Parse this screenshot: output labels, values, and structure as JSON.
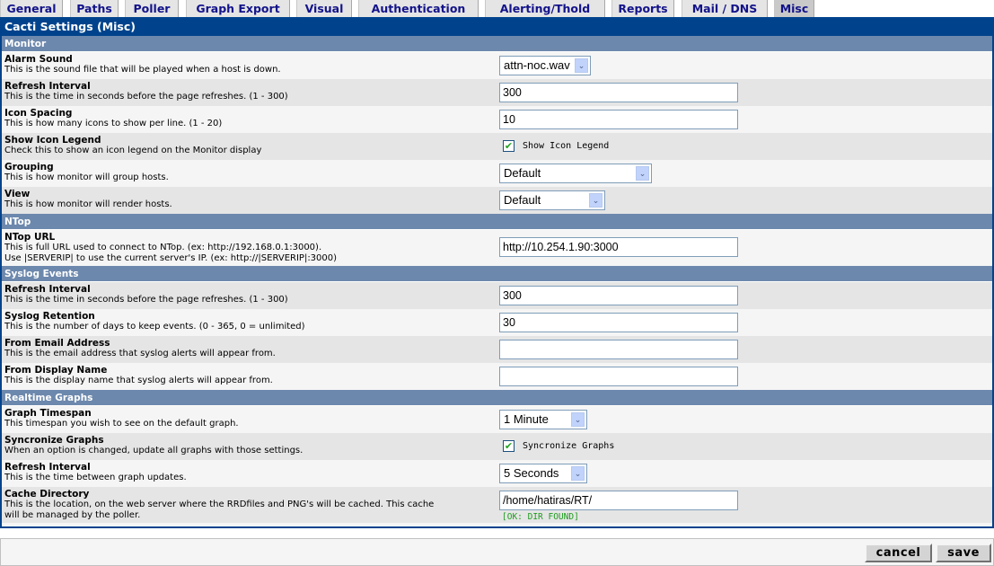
{
  "tabs": [
    {
      "label": "General",
      "active": false
    },
    {
      "label": "Paths",
      "active": false
    },
    {
      "label": "Poller",
      "active": false
    },
    {
      "label": "Graph Export",
      "active": false
    },
    {
      "label": "Visual",
      "active": false
    },
    {
      "label": "Authentication",
      "active": false
    },
    {
      "label": "Alerting/Thold",
      "active": false
    },
    {
      "label": "Reports",
      "active": false
    },
    {
      "label": "Mail / DNS",
      "active": false
    },
    {
      "label": "Misc",
      "active": true
    }
  ],
  "title": "Cacti Settings (Misc)",
  "sections": {
    "monitor": {
      "header": "Monitor",
      "alarm_sound": {
        "name": "Alarm Sound",
        "desc": "This is the sound file that will be played when a host is down.",
        "value": "attn-noc.wav"
      },
      "refresh_interval": {
        "name": "Refresh Interval",
        "desc": "This is the time in seconds before the page refreshes. (1 - 300)",
        "value": "300"
      },
      "icon_spacing": {
        "name": "Icon Spacing",
        "desc": "This is how many icons to show per line. (1 - 20)",
        "value": "10"
      },
      "show_icon_legend": {
        "name": "Show Icon Legend",
        "desc": "Check this to show an icon legend on the Monitor display",
        "checkbox_label": "Show Icon Legend",
        "checked": true
      },
      "grouping": {
        "name": "Grouping",
        "desc": "This is how monitor will group hosts.",
        "value": "Default"
      },
      "view": {
        "name": "View",
        "desc": "This is how monitor will render hosts.",
        "value": "Default"
      }
    },
    "ntop": {
      "header": "NTop",
      "ntop_url": {
        "name": "NTop URL",
        "desc1": "This is full URL used to connect to NTop. (ex: http://192.168.0.1:3000).",
        "desc2": "Use |SERVERIP| to use the current server's IP. (ex: http://|SERVERIP|:3000)",
        "value": "http://10.254.1.90:3000"
      }
    },
    "syslog": {
      "header": "Syslog Events",
      "refresh_interval": {
        "name": "Refresh Interval",
        "desc": "This is the time in seconds before the page refreshes. (1 - 300)",
        "value": "300"
      },
      "retention": {
        "name": "Syslog Retention",
        "desc": "This is the number of days to keep events. (0 - 365, 0 = unlimited)",
        "value": "30"
      },
      "from_email": {
        "name": "From Email Address",
        "desc": "This is the email address that syslog alerts will appear from.",
        "value": ""
      },
      "from_name": {
        "name": "From Display Name",
        "desc": "This is the display name that syslog alerts will appear from.",
        "value": ""
      }
    },
    "realtime": {
      "header": "Realtime Graphs",
      "timespan": {
        "name": "Graph Timespan",
        "desc": "This timespan you wish to see on the default graph.",
        "value": "1 Minute"
      },
      "syncronize": {
        "name": "Syncronize Graphs",
        "desc": "When an option is changed, update all graphs with those settings.",
        "checkbox_label": "Syncronize Graphs",
        "checked": true
      },
      "refresh_interval": {
        "name": "Refresh Interval",
        "desc": "This is the time between graph updates.",
        "value": "5 Seconds"
      },
      "cache_dir": {
        "name": "Cache Directory",
        "desc1": "This is the location, on the web server where the RRDfiles and PNG's will be cached. This cache",
        "desc2": "will be managed by the poller.",
        "value": "/home/hatiras/RT/",
        "status": "[OK: DIR FOUND]"
      }
    }
  },
  "footer": {
    "cancel_label": "cancel",
    "save_label": "save"
  },
  "icons": {
    "check": "✔",
    "dropdown": "⌄"
  }
}
